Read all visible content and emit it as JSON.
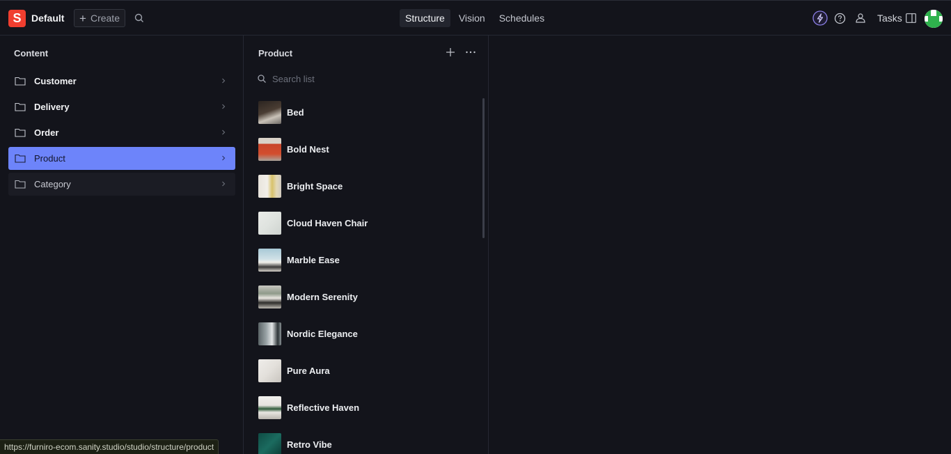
{
  "navbar": {
    "logo_letter": "S",
    "workspace": "Default",
    "create_label": "Create",
    "tabs": [
      {
        "label": "Structure",
        "active": true
      },
      {
        "label": "Vision",
        "active": false
      },
      {
        "label": "Schedules",
        "active": false
      }
    ],
    "tasks_label": "Tasks",
    "icons": [
      "lightning-icon",
      "help-icon",
      "people-icon",
      "panel-icon"
    ]
  },
  "content_pane": {
    "title": "Content",
    "items": [
      {
        "label": "Customer",
        "state": "normal"
      },
      {
        "label": "Delivery",
        "state": "normal"
      },
      {
        "label": "Order",
        "state": "normal"
      },
      {
        "label": "Product",
        "state": "selected"
      },
      {
        "label": "Category",
        "state": "hover"
      }
    ]
  },
  "product_pane": {
    "title": "Product",
    "search_placeholder": "Search list",
    "items": [
      {
        "name": "Bed"
      },
      {
        "name": "Bold Nest"
      },
      {
        "name": "Bright Space"
      },
      {
        "name": "Cloud Haven Chair"
      },
      {
        "name": "Marble Ease"
      },
      {
        "name": "Modern Serenity"
      },
      {
        "name": "Nordic Elegance"
      },
      {
        "name": "Pure Aura"
      },
      {
        "name": "Reflective Haven"
      },
      {
        "name": "Retro Vibe"
      }
    ]
  },
  "status_bar": {
    "url": "https://furniro-ecom.sanity.studio/studio/structure/product"
  },
  "colors": {
    "background": "#13141b",
    "accent_selected": "#6d84fa",
    "logo": "#f03e2f"
  }
}
